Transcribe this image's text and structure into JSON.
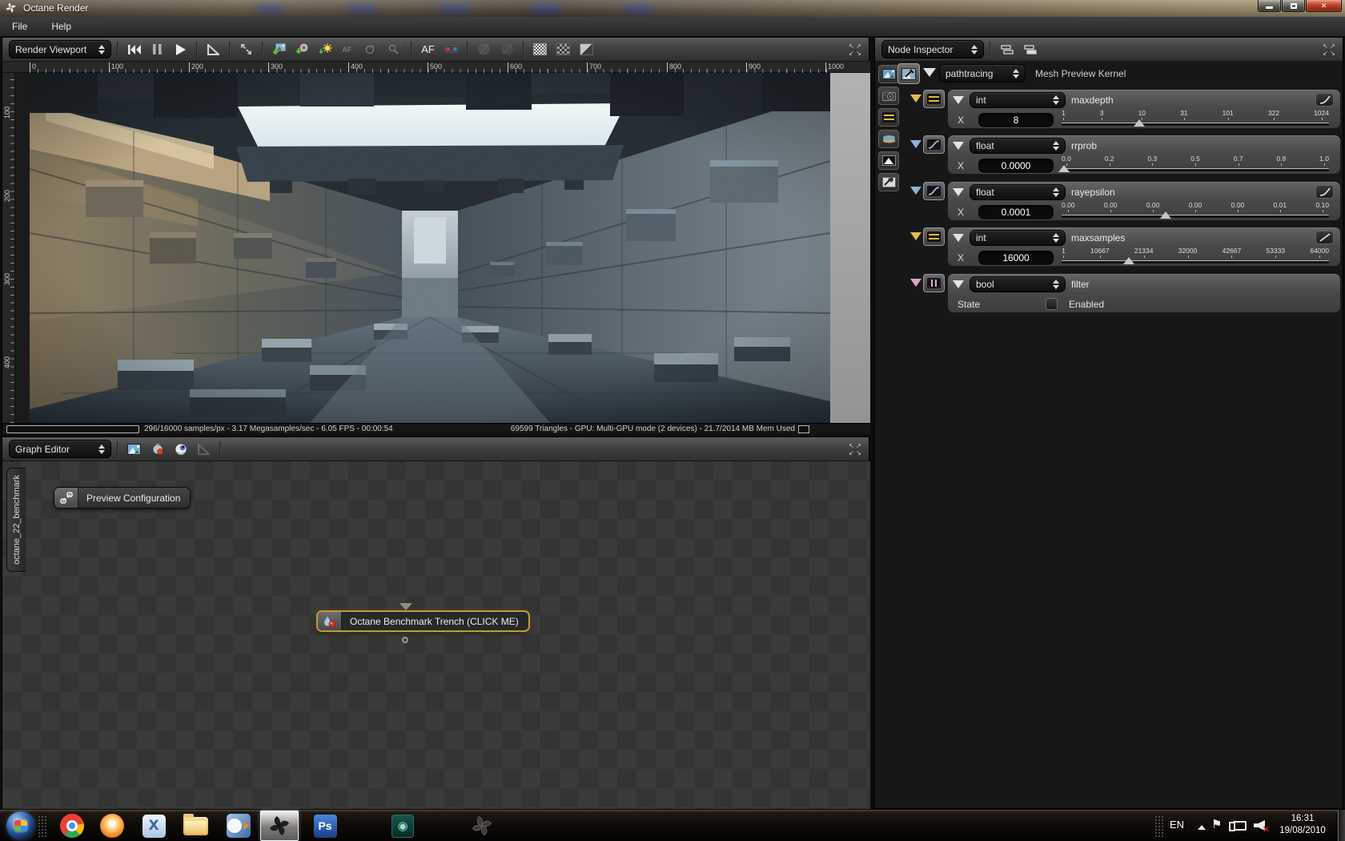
{
  "window": {
    "title": "Octane Render",
    "menu_file": "File",
    "menu_help": "Help",
    "control_icons": [
      "minimize-icon",
      "maximize-icon",
      "close-icon"
    ]
  },
  "render_viewport": {
    "panel_title": "Render Viewport",
    "toolbar_icons": [
      "restart-render-icon",
      "pause-render-icon",
      "start-render-icon",
      "set-square-icon",
      "fit-view-icon",
      "save-image-icon",
      "save-render-state-icon",
      "daylight-icon",
      "af-lock-icon",
      "rotate-lock-icon",
      "zoom-lock-icon",
      "af-icon",
      "anaglyph-icon",
      "material-ball-icon",
      "material-ball-alt-icon",
      "film-grain-icon",
      "checker-background-icon",
      "split-compare-icon"
    ],
    "af_locked_label": "AF",
    "af_label": "AF",
    "ruler_top": [
      "0",
      "100",
      "200",
      "300",
      "400",
      "500",
      "600",
      "700",
      "800",
      "900",
      "1000"
    ],
    "ruler_left": [
      "100",
      "200",
      "300",
      "400"
    ],
    "status_left": "296/16000 samples/px - 3.17 Megasamples/sec - 6.05 FPS - 00:00:54",
    "status_right": "69599 Triangles - GPU: Multi-GPU mode (2 devices) - 21.7/2014 MB Mem Used"
  },
  "graph_editor": {
    "panel_title": "Graph Editor",
    "toolbar_icons": [
      "add-image-node-icon",
      "add-material-node-icon",
      "add-texture-node-icon",
      "delete-node-icon"
    ],
    "tab_label": "octane_22_benchmark",
    "nodes": [
      {
        "label": "Preview Configuration"
      },
      {
        "label": "Octane Benchmark Trench (CLICK ME)"
      }
    ]
  },
  "node_inspector": {
    "panel_title": "Node Inspector",
    "header_icons": [
      "collapse-nodes-icon",
      "expand-nodes-icon"
    ],
    "category_icons": [
      "image-icon",
      "camera-icon",
      "kernel-icon",
      "environment-icon",
      "imager-icon",
      "postprocess-icon"
    ],
    "node_type_value": "pathtracing",
    "node_title": "Mesh Preview Kernel",
    "params": [
      {
        "type": "int",
        "name": "maxdepth",
        "axis_label": "X",
        "value": "8",
        "ticks": [
          "1",
          "3",
          "10",
          "31",
          "101",
          "322",
          "1024"
        ]
      },
      {
        "type": "float",
        "name": "rrprob",
        "axis_label": "X",
        "value": "0.0000",
        "ticks": [
          "0.0",
          "0.2",
          "0.3",
          "0.5",
          "0.7",
          "0.8",
          "1.0"
        ]
      },
      {
        "type": "float",
        "name": "rayepsilon",
        "axis_label": "X",
        "value": "0.0001",
        "ticks": [
          "0.00",
          "0.00",
          "0.00",
          "0.00",
          "0.00",
          "0.01",
          "0.10"
        ]
      },
      {
        "type": "int",
        "name": "maxsamples",
        "axis_label": "X",
        "value": "16000",
        "ticks": [
          "1",
          "10667",
          "21334",
          "32000",
          "42667",
          "53333",
          "64000"
        ]
      },
      {
        "type": "bool",
        "name": "filter",
        "state_label": "State",
        "state_value": "Enabled",
        "checked": false
      }
    ],
    "pin_colors": {
      "int": "#e3bb48",
      "float": "#8fb3d9",
      "bool": "#dba8cc"
    }
  },
  "taskbar": {
    "icons": [
      "start-button",
      "chrome-icon",
      "bitcomet-icon",
      "x-app-icon",
      "explorer-icon",
      "media-player-icon",
      "octane-render-taskbar-icon",
      "photoshop-icon",
      "teal-app-icon",
      "octane-shortcut-icon"
    ],
    "photoshop_label": "Ps",
    "language": "EN",
    "time": "16:31",
    "date": "19/08/2010"
  },
  "colors": {
    "node_selection": "#c09a3e",
    "viewport_gutter": "#a5a5a5"
  }
}
